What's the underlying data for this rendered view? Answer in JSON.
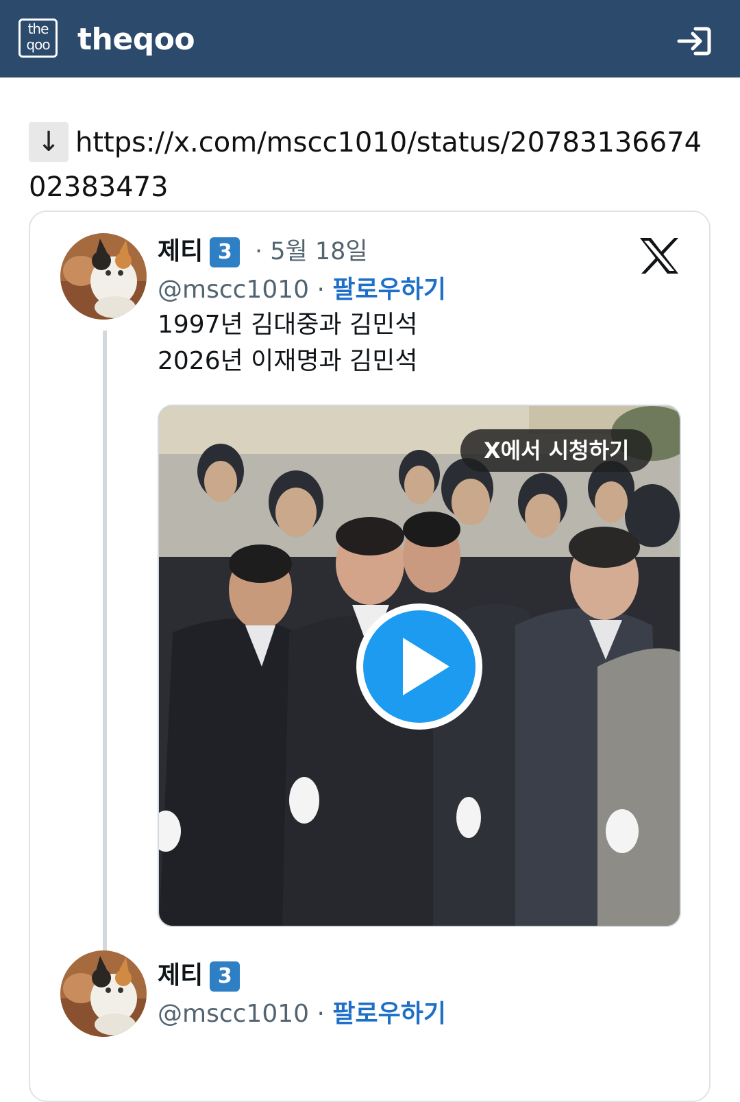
{
  "header": {
    "logo_line1": "the",
    "logo_line2": "qoo",
    "site_name": "theqoo",
    "login_icon": "login-arrow-icon"
  },
  "post": {
    "arrow": "↓",
    "link": "https://x.com/mscc1010/status/2078313667402383473"
  },
  "tweet": {
    "author_name": "제티",
    "badge": "3",
    "date": "· 5월 18일",
    "handle": "@mscc1010",
    "separator": " · ",
    "follow_label": "팔로우하기",
    "text_line1": "1997년 김대중과 김민석",
    "text_line2": "2026년 이재명과 김민석",
    "video_button": "X에서 시청하기",
    "platform_icon": "x-logo-icon",
    "play_icon": "play-icon"
  },
  "reply": {
    "author_name": "제티",
    "badge": "3",
    "handle": "@mscc1010",
    "separator": " · ",
    "follow_label": "팔로우하기"
  },
  "colors": {
    "header_bg": "#2c4a6b",
    "follow_blue": "#1d6fc7",
    "badge_blue": "#2f7fc4",
    "play_blue": "#1d9bf0"
  }
}
